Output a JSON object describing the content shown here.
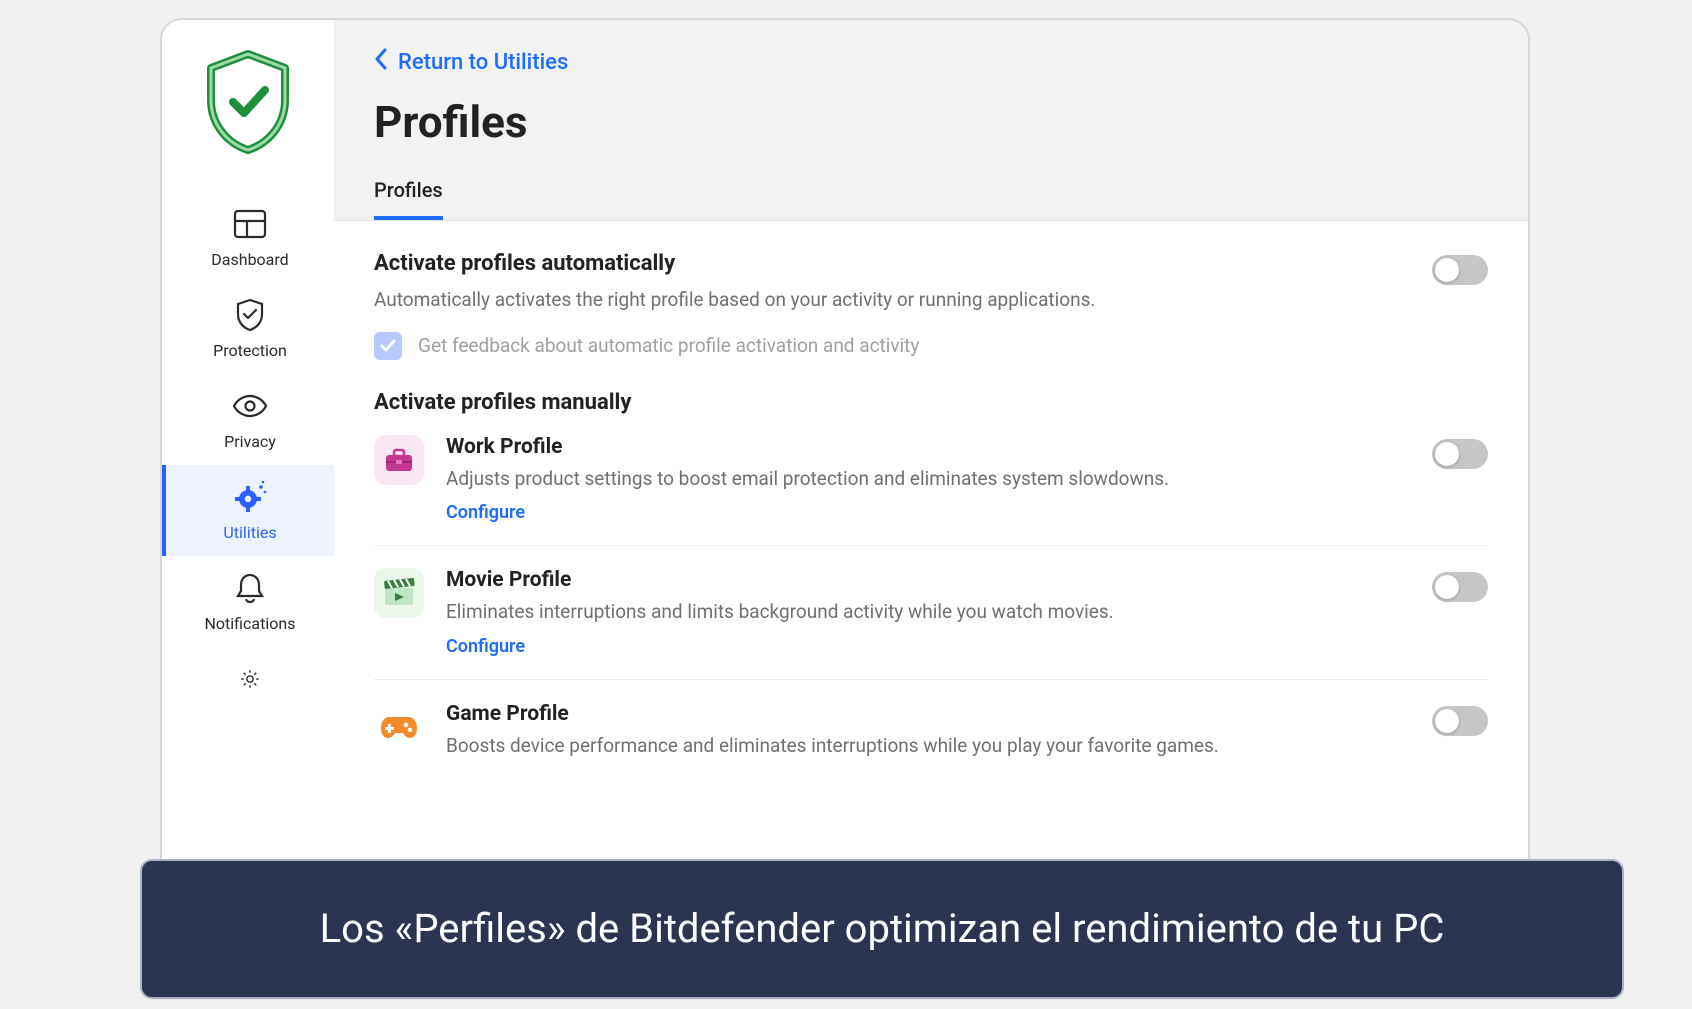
{
  "sidebar": {
    "items": [
      {
        "label": "Dashboard"
      },
      {
        "label": "Protection"
      },
      {
        "label": "Privacy"
      },
      {
        "label": "Utilities"
      },
      {
        "label": "Notifications"
      }
    ]
  },
  "header": {
    "back_label": "Return to Utilities",
    "title": "Profiles"
  },
  "tabs": [
    {
      "label": "Profiles",
      "active": true
    }
  ],
  "auto_section": {
    "title": "Activate profiles automatically",
    "desc": "Automatically activates the right profile based on your activity or running applications.",
    "checkbox_label": "Get feedback about automatic profile activation and activity"
  },
  "manual_section": {
    "title": "Activate profiles manually",
    "configure_label": "Configure",
    "profiles": [
      {
        "name": "Work Profile",
        "desc": "Adjusts product settings to boost email protection and eliminates system slowdowns."
      },
      {
        "name": "Movie Profile",
        "desc": "Eliminates interruptions and limits background activity while you watch movies."
      },
      {
        "name": "Game Profile",
        "desc": "Boosts device performance and eliminates interruptions while you play your favorite games."
      }
    ]
  },
  "caption": "Los «Perfiles» de Bitdefender optimizan el rendimiento de tu PC"
}
